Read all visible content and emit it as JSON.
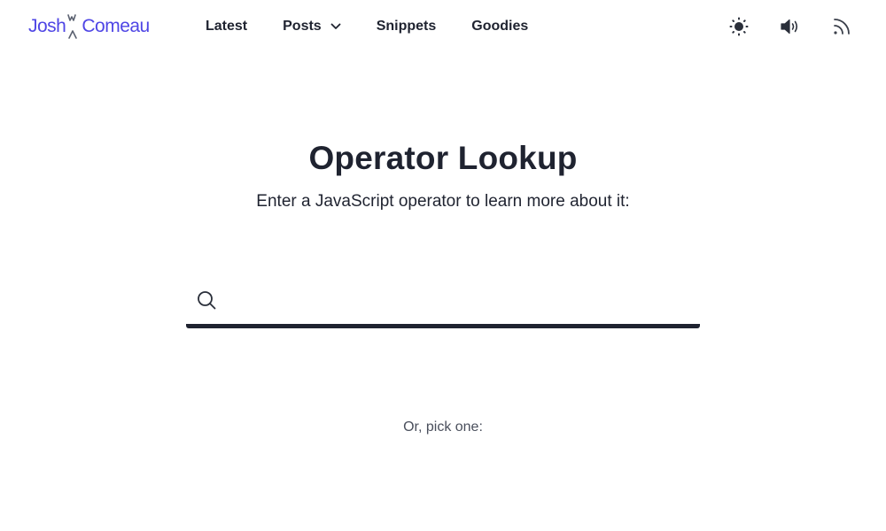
{
  "header": {
    "logo": {
      "first": "Josh",
      "last": "Comeau"
    },
    "nav": [
      {
        "label": "Latest"
      },
      {
        "label": "Posts",
        "has_dropdown": true
      },
      {
        "label": "Snippets"
      },
      {
        "label": "Goodies"
      }
    ],
    "icons": [
      "sun-icon",
      "speaker-icon",
      "rss-icon"
    ]
  },
  "main": {
    "title": "Operator Lookup",
    "subtitle": "Enter a JavaScript operator to learn more about it:",
    "search": {
      "value": "",
      "placeholder": ""
    },
    "pick_label": "Or, pick one:"
  },
  "colors": {
    "brand": "#4f46e5",
    "text": "#1f2330",
    "muted": "#4a4f5c"
  }
}
